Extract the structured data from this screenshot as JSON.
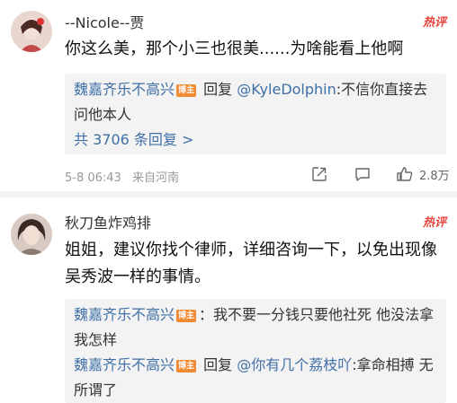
{
  "comments": [
    {
      "username": "--Nicole--贾",
      "hot_label": "热评",
      "text": "你这么美，那个小三也很美......为啥能看上他啊",
      "replies": [
        {
          "author": "魏嘉齐乐不高兴",
          "badge": "博主",
          "prefix": "回复",
          "mention": "@KyleDolphin",
          "content": ":不信你直接去问他本人"
        }
      ],
      "more_replies": "共 3706 条回复 >",
      "time": "5-8 06:43",
      "location": "来自河南",
      "likes": "2.8万"
    },
    {
      "username": "秋刀鱼炸鸡排",
      "hot_label": "热评",
      "text": "姐姐，建议你找个律师，详细咨询一下，以免出现像吴秀波一样的事情。",
      "replies": [
        {
          "author": "魏嘉齐乐不高兴",
          "badge": "博主",
          "content": "：我不要一分钱只要他社死 他没法拿我怎样"
        },
        {
          "author": "魏嘉齐乐不高兴",
          "badge": "博主",
          "prefix": "回复",
          "mention": "@你有几个荔枝吖",
          "content": ":拿命相搏 无所谓了"
        }
      ]
    }
  ],
  "colors": {
    "link": "#3f6fa7",
    "hot": "#e6433c",
    "badge": "#f08a33"
  },
  "icons": [
    "share-icon",
    "comment-icon",
    "like-icon"
  ]
}
